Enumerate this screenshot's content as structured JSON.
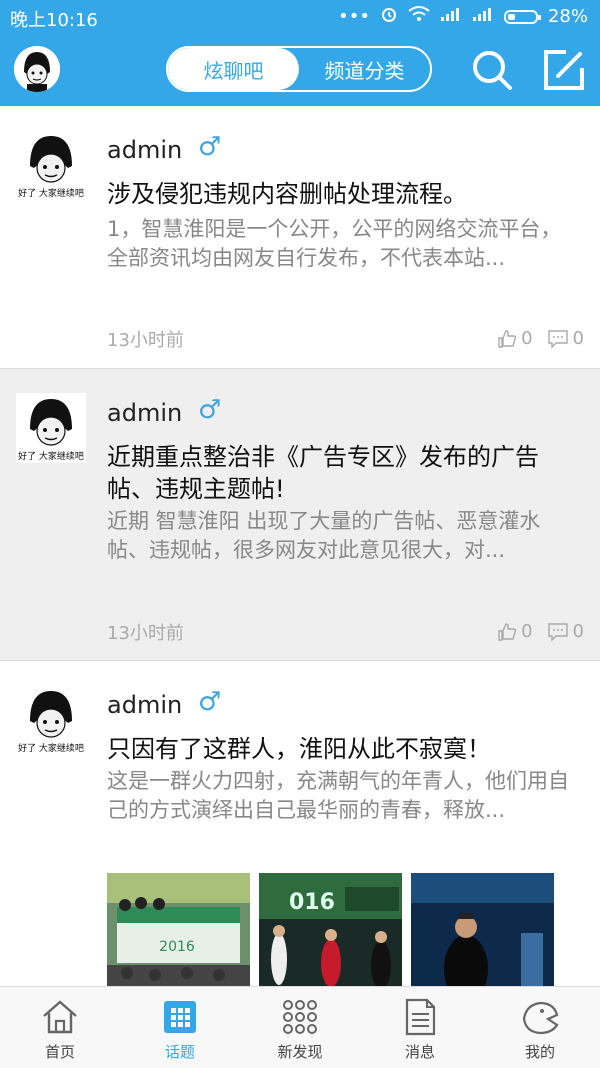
{
  "status_bar": {
    "time": "晚上10:16",
    "battery_text": "28%",
    "battery_level": 0.28
  },
  "header": {
    "tabs": [
      {
        "label": "炫聊吧",
        "active": true
      },
      {
        "label": "频道分类",
        "active": false
      }
    ],
    "icons": [
      "avatar",
      "search-icon",
      "compose-icon"
    ]
  },
  "avatar_caption": "好了 大家继续吧",
  "posts": [
    {
      "author": "admin",
      "gender_symbol": "♂",
      "title": "涉及侵犯违规内容删帖处理流程。",
      "excerpt": "1，智慧淮阳是一个公开，公平的网络交流平台，全部资讯均由网友自行发布，不代表本站...",
      "time": "13小时前",
      "likes": "0",
      "comments": "0"
    },
    {
      "author": "admin",
      "gender_symbol": "♂",
      "title": "近期重点整治非《广告专区》发布的广告帖、违规主题帖!",
      "excerpt": "近期 智慧淮阳 出现了大量的广告帖、恶意灌水帖、违规帖，很多网友对此意见很大，对...",
      "time": "13小时前",
      "likes": "0",
      "comments": "0"
    },
    {
      "author": "admin",
      "gender_symbol": "♂",
      "title": "只因有了这群人，淮阳从此不寂寞！",
      "excerpt": "这是一群火力四射，充满朝气的年青人，他们用自己的方式演绎出自己最华丽的青春，释放...",
      "images": [
        "event-photo-stage",
        "event-photo-performers",
        "event-photo-host"
      ]
    }
  ],
  "bottom_nav": [
    {
      "label": "首页",
      "icon": "home-icon",
      "active": false
    },
    {
      "label": "话题",
      "icon": "topics-icon",
      "active": true
    },
    {
      "label": "新发现",
      "icon": "discover-icon",
      "active": false
    },
    {
      "label": "消息",
      "icon": "message-icon",
      "active": false
    },
    {
      "label": "我的",
      "icon": "profile-icon",
      "active": false
    }
  ],
  "colors": {
    "accent": "#34a7e8",
    "background": "#f4f4f4",
    "card_white": "#ffffff",
    "card_gray": "#efefef"
  }
}
